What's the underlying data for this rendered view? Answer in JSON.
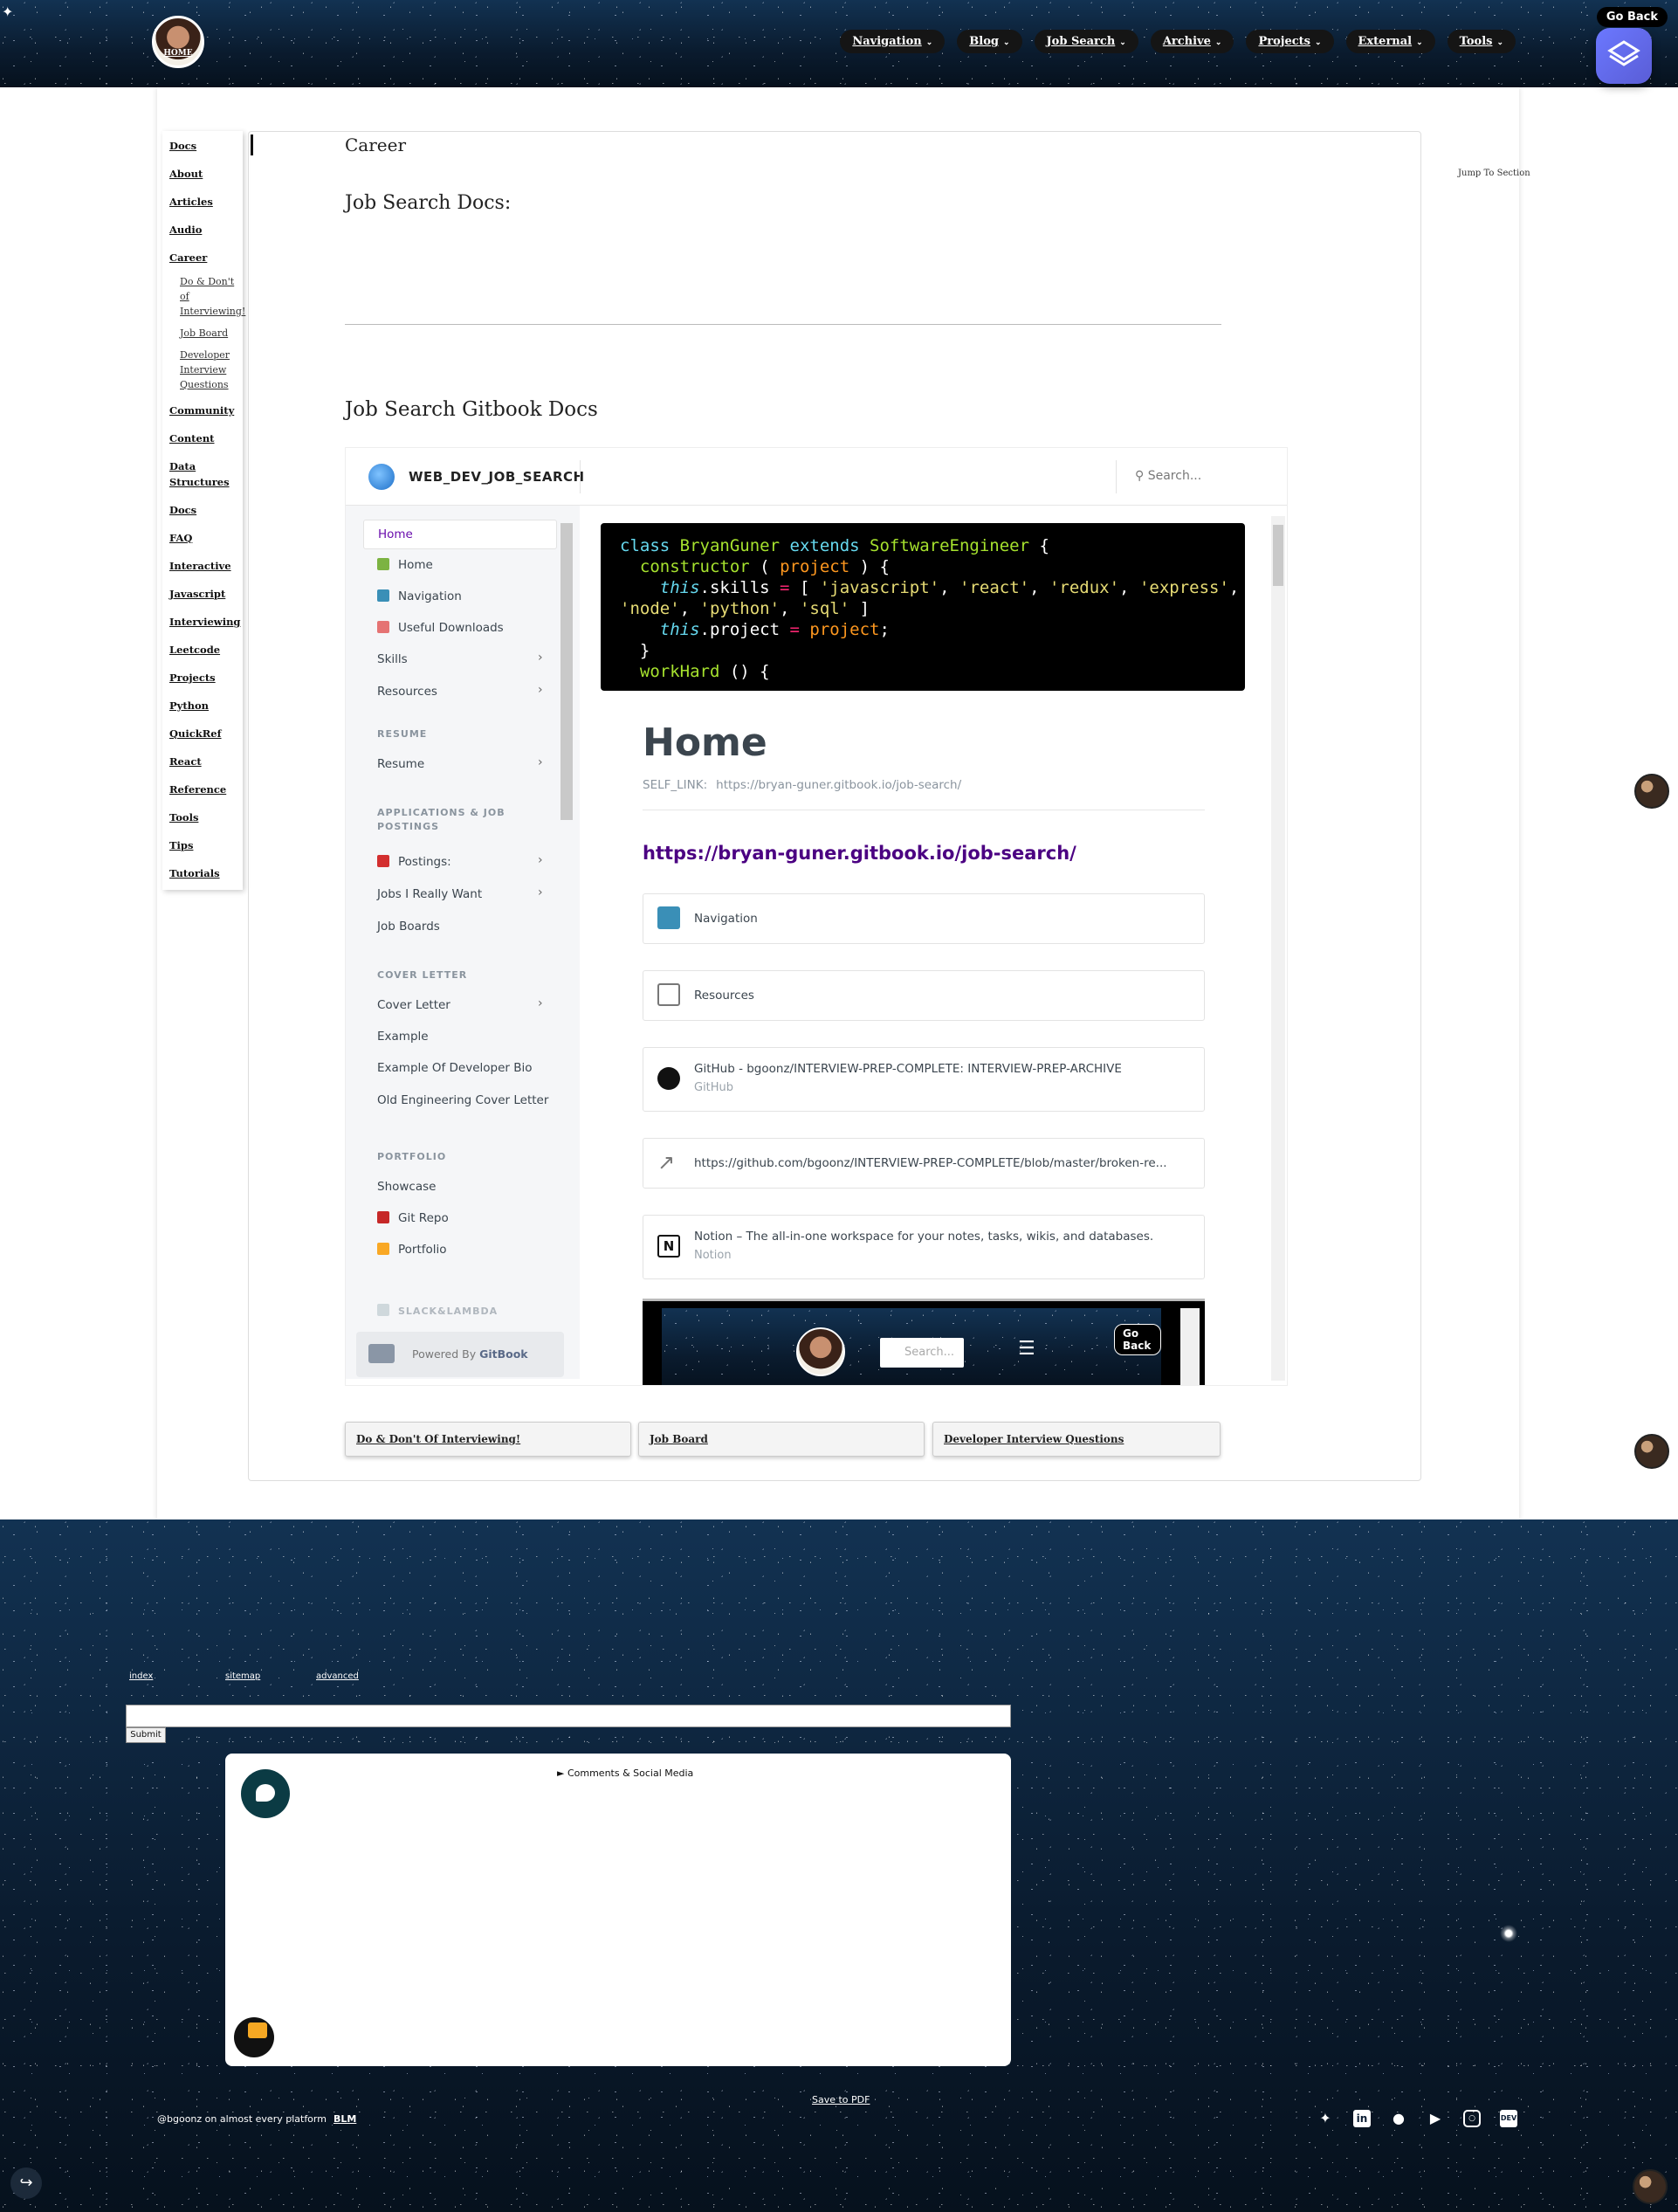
{
  "header": {
    "home_label": "HOME",
    "nav": [
      "Navigation",
      "Blog",
      "Job Search",
      "Archive",
      "Projects",
      "External",
      "Tools"
    ],
    "go_back": "Go Back"
  },
  "sidebar": {
    "items": [
      {
        "label": "Docs"
      },
      {
        "label": "About"
      },
      {
        "label": "Articles"
      },
      {
        "label": "Audio"
      },
      {
        "label": "Career",
        "children": [
          "Do & Don't of Interviewing!",
          "Job Board",
          "Developer Interview Questions"
        ]
      },
      {
        "label": "Community"
      },
      {
        "label": "Content"
      },
      {
        "label": "Data Structures"
      },
      {
        "label": "Docs"
      },
      {
        "label": "FAQ"
      },
      {
        "label": "Interactive"
      },
      {
        "label": "Javascript"
      },
      {
        "label": "Interviewing"
      },
      {
        "label": "Leetcode"
      },
      {
        "label": "Projects"
      },
      {
        "label": "Python"
      },
      {
        "label": "QuickRef"
      },
      {
        "label": "React"
      },
      {
        "label": "Reference"
      },
      {
        "label": "Tools"
      },
      {
        "label": "Tips"
      },
      {
        "label": "Tutorials"
      }
    ]
  },
  "content": {
    "breadcrumb": "Career",
    "section_title": "Job Search Docs:",
    "gitbook_title": "Job Search Gitbook Docs",
    "jump": "Jump To Section"
  },
  "gitbook": {
    "space_name": "WEB_DEV_JOB_SEARCH",
    "search_placeholder": "Search...",
    "nav_active": "Home",
    "nav_items": [
      "Home",
      "Navigation",
      "Useful Downloads",
      "Skills",
      "Resources"
    ],
    "sec_resume": "RESUME",
    "resume": "Resume",
    "sec_apps": "APPLICATIONS & JOB POSTINGS",
    "apps_items": [
      "Postings:",
      "Jobs I Really Want",
      "Job Boards"
    ],
    "sec_cover": "COVER LETTER",
    "cover_items": [
      "Cover Letter",
      "Example",
      "Example Of Developer Bio",
      "Old Engineering Cover Letter"
    ],
    "sec_portfolio": "PORTFOLIO",
    "portfolio_items": [
      "Showcase",
      "Git Repo",
      "Portfolio"
    ],
    "sec_slack": "SLACK&LAMBDA",
    "powered_by": "Powered By",
    "powered_brand": "GitBook",
    "page_title": "Home",
    "self_link_label": "SELF_LINK:",
    "self_link_url": "https://bryan-guner.gitbook.io/job-search/",
    "big_link": "https://bryan-guner.gitbook.io/job-search/",
    "cards": [
      {
        "title": "Navigation",
        "sub": ""
      },
      {
        "title": "Resources",
        "sub": ""
      },
      {
        "title": "GitHub - bgoonz/INTERVIEW-PREP-COMPLETE: INTERVIEW-PREP-ARCHIVE",
        "sub": "GitHub"
      },
      {
        "title": "https://github.com/bgoonz/INTERVIEW-PREP-COMPLETE/blob/master/broken-re...",
        "sub": ""
      },
      {
        "title": "Notion – The all-in-one workspace for your notes, tasks, wikis, and databases.",
        "sub": "Notion"
      }
    ],
    "mini": {
      "home": "HOME",
      "search": "Search...",
      "go_back": "Go Back"
    }
  },
  "page_links": [
    "Do & Don't Of Interviewing!",
    "Job Board",
    "Developer Interview Questions"
  ],
  "footer": {
    "links": [
      "index",
      "sitemap",
      "advanced"
    ],
    "submit": "Submit",
    "comments": "► Comments & Social Media",
    "save_pdf": "Save to PDF",
    "copyright": "@bgoonz on almost every platform",
    "blm": "BLM",
    "social_icons": [
      "twitter-icon",
      "linkedin-icon",
      "github-icon",
      "youtube-icon",
      "instagram-icon",
      "dev-icon"
    ]
  }
}
